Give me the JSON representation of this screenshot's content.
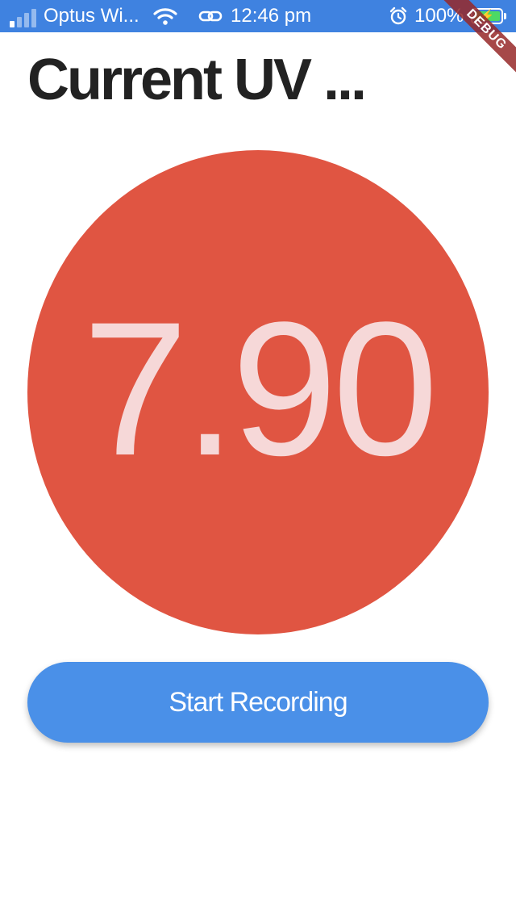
{
  "status_bar": {
    "carrier": "Optus Wi...",
    "time": "12:46 pm",
    "battery_percent": "100%",
    "battery_level": 1.0,
    "signal_bars": 4,
    "signal_bars_active": 1,
    "icons": [
      "signal-icon",
      "wifi-icon",
      "link-icon",
      "alarm-icon",
      "battery-icon"
    ],
    "colors": {
      "background": "#3f82e0",
      "battery_fill": "#4cd964"
    }
  },
  "debug_banner": {
    "label": "DEBUG"
  },
  "header": {
    "title": "Current UV ..."
  },
  "uv_display": {
    "value": "7.90",
    "colors": {
      "circle": "#e05542",
      "text": "#f6d8d8"
    }
  },
  "actions": {
    "record_label": "Start Recording",
    "colors": {
      "button": "#4a90e8",
      "text": "#ffffff"
    }
  }
}
